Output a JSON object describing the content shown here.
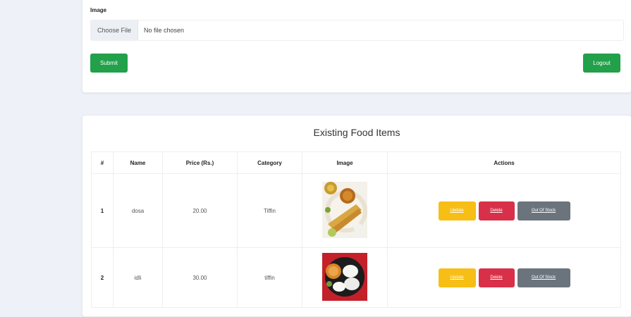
{
  "form": {
    "image_label": "Image",
    "file_button": "Choose File",
    "file_status": "No file chosen",
    "submit_label": "Submit",
    "logout_label": "Logout"
  },
  "table": {
    "title": "Existing Food Items",
    "headers": [
      "#",
      "Name",
      "Price (Rs.)",
      "Category",
      "Image",
      "Actions"
    ],
    "rows": [
      {
        "num": "1",
        "name": "dosa",
        "price": "20.00",
        "category": "Tiffin",
        "image_icon": "dosa-photo"
      },
      {
        "num": "2",
        "name": "idli",
        "price": "30.00",
        "category": "tiffin",
        "image_icon": "idli-photo"
      }
    ],
    "actions": {
      "update": "Update",
      "delete": "Delete",
      "out_of_stock": "Out Of Stock"
    }
  },
  "colors": {
    "green": "#22a04a",
    "yellow": "#f7be16",
    "red": "#d9304a",
    "gray": "#6b747d"
  }
}
